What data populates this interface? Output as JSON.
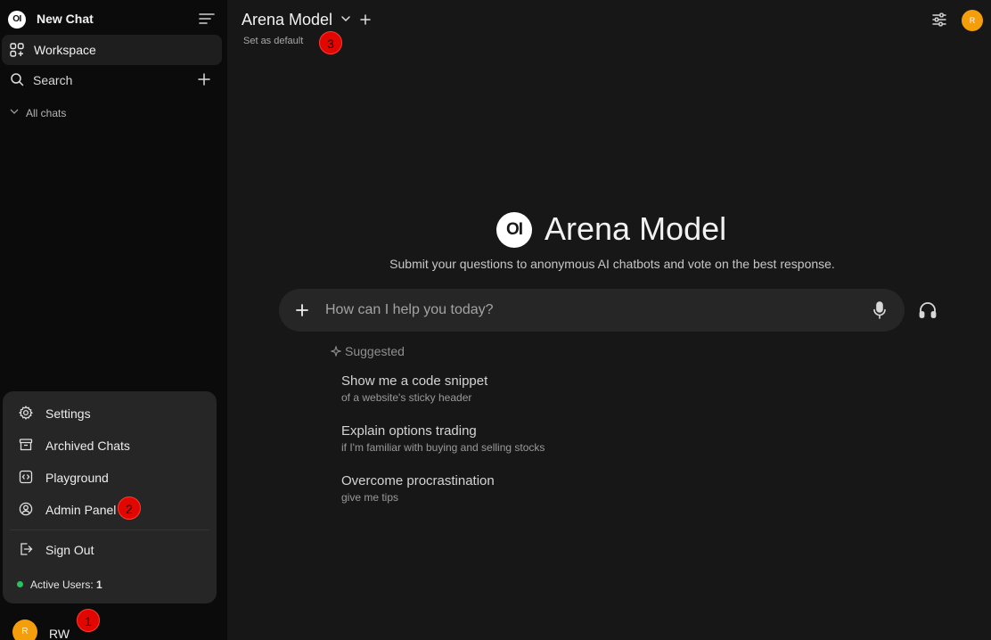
{
  "sidebar": {
    "logo_text": "OI",
    "new_chat_label": "New Chat",
    "workspace_label": "Workspace",
    "search_label": "Search",
    "all_chats_label": "All chats"
  },
  "user_menu": {
    "items": [
      {
        "label": "Settings",
        "icon": "gear-icon"
      },
      {
        "label": "Archived Chats",
        "icon": "archive-icon"
      },
      {
        "label": "Playground",
        "icon": "code-icon"
      },
      {
        "label": "Admin Panel",
        "icon": "user-circle-icon"
      },
      {
        "label": "Sign Out",
        "icon": "sign-out-icon"
      }
    ],
    "active_users_label": "Active Users:",
    "active_users_count": "1"
  },
  "user": {
    "initial": "R",
    "name": "RW"
  },
  "badges": [
    "1",
    "2",
    "3"
  ],
  "header": {
    "model_name": "Arena Model",
    "set_default_label": "Set as default",
    "avatar_initial": "R"
  },
  "hero": {
    "logo_text": "OI",
    "title": "Arena Model",
    "subtitle": "Submit your questions to anonymous AI chatbots and vote on the best response."
  },
  "chat_input": {
    "placeholder": "How can I help you today?"
  },
  "suggested": {
    "label": "Suggested",
    "items": [
      {
        "title": "Show me a code snippet",
        "subtitle": "of a website's sticky header"
      },
      {
        "title": "Explain options trading",
        "subtitle": "if I'm familiar with buying and selling stocks"
      },
      {
        "title": "Overcome procrastination",
        "subtitle": "give me tips"
      }
    ]
  },
  "colors": {
    "accent_avatar": "#f59e0b",
    "active_dot": "#22c55e",
    "badge": "#e10600"
  }
}
